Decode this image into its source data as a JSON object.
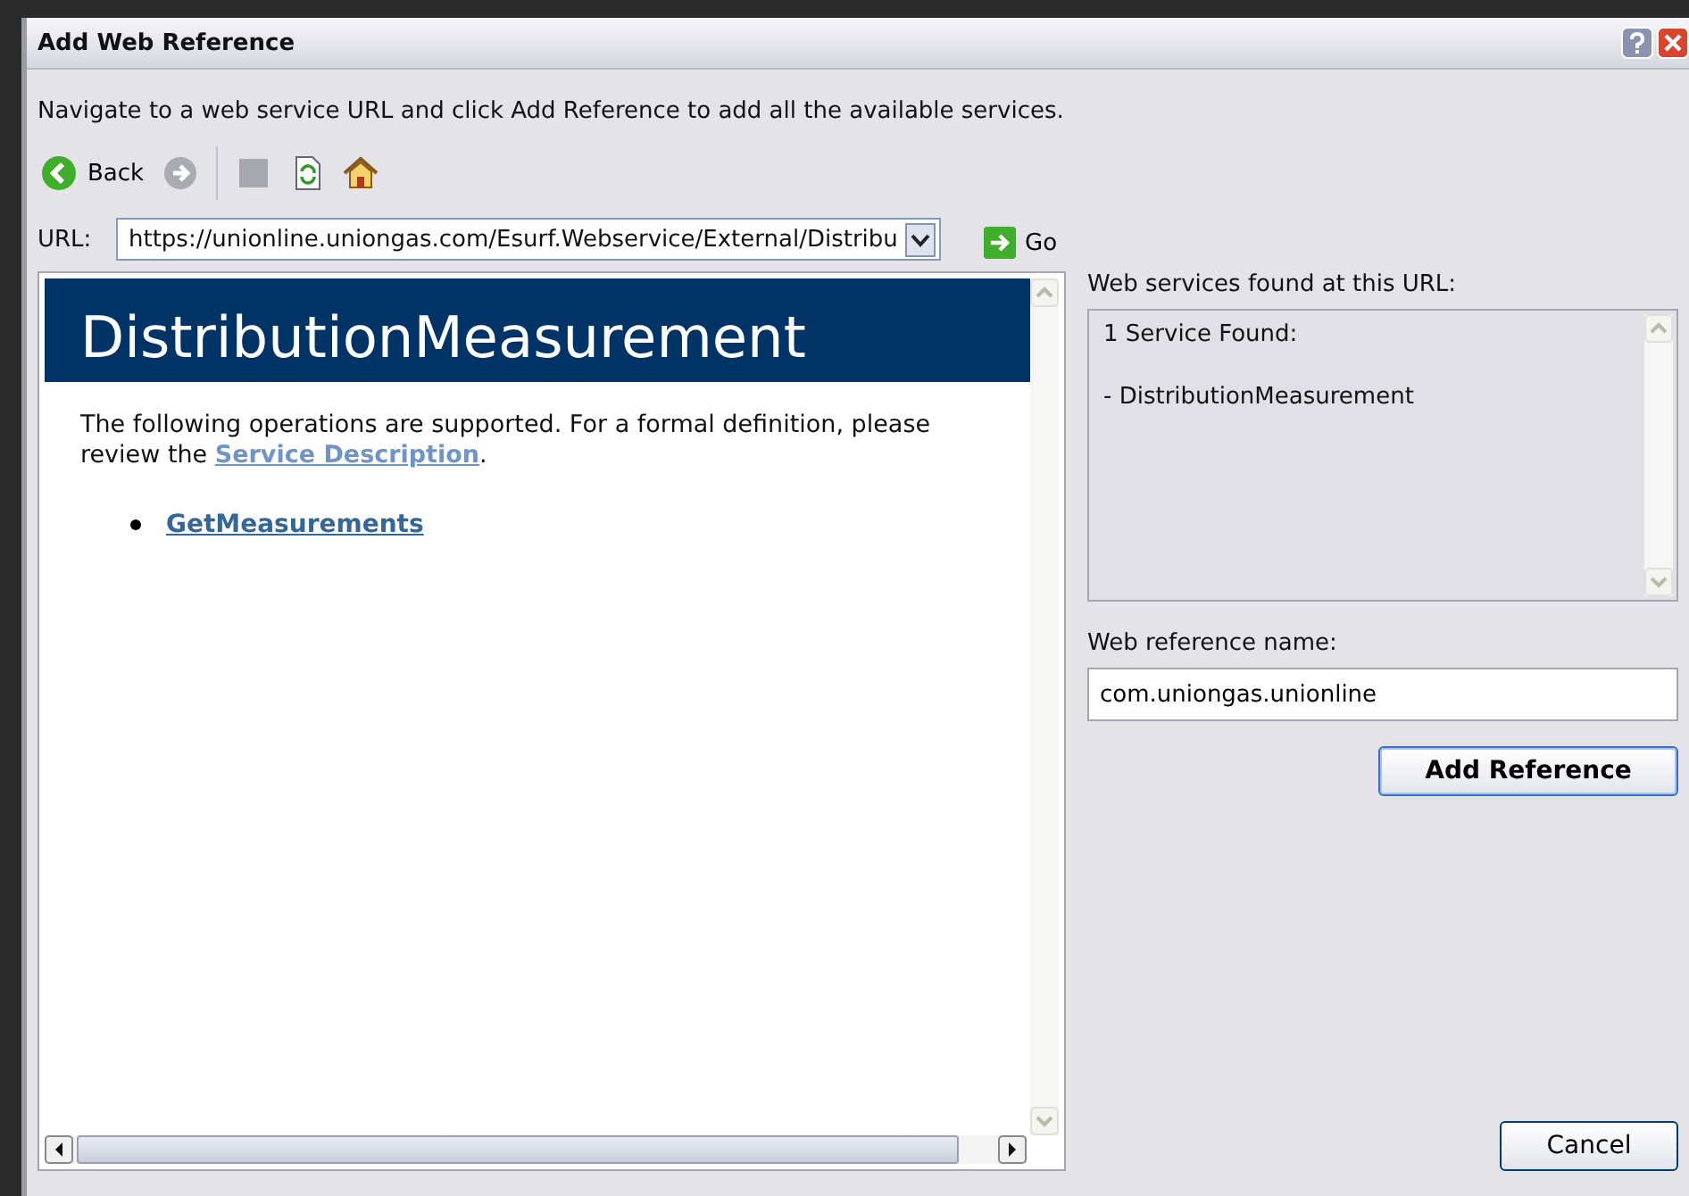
{
  "window": {
    "title": "Add Web Reference"
  },
  "instructions": "Navigate to a web service URL and click Add Reference to add all the available services.",
  "toolbar": {
    "back_label": "Back"
  },
  "url_bar": {
    "label": "URL:",
    "value": "https://unionline.uniongas.com/Esurf.Webservice/External/Distribu",
    "go_label": "Go"
  },
  "browser": {
    "heading": "DistributionMeasurement",
    "intro": "The following operations are supported. For a formal definition, please review the ",
    "intro_link": "Service Description",
    "intro_end": ".",
    "operations": [
      "GetMeasurements"
    ]
  },
  "services": {
    "label": "Web services found at this URL:",
    "lines": [
      "1 Service Found:",
      "- DistributionMeasurement"
    ]
  },
  "reference": {
    "label": "Web reference name:",
    "value": "com.uniongas.unionline"
  },
  "buttons": {
    "add": "Add Reference",
    "cancel": "Cancel"
  }
}
